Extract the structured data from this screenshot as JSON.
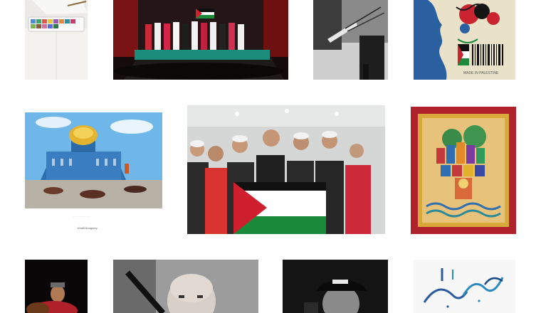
{
  "gallery": {
    "tiles": [
      {
        "id": "watercolor-palette",
        "alt": "Watercolor palette and brushes on a table",
        "caption": ""
      },
      {
        "id": "dabke-stage",
        "alt": "Dance troupe bowing on stage holding flags",
        "caption": ""
      },
      {
        "id": "artist-studio",
        "alt": "Black and white photo of an artist studio",
        "caption": ""
      },
      {
        "id": "made-in-palestine-poster",
        "alt": "Poster of a woman profile with barcode",
        "caption": "MADE IN PALESTINE"
      },
      {
        "id": "dome-of-rock-painting",
        "alt": "Surreal painting of the Dome of the Rock",
        "caption": "Khalil Anoguery"
      },
      {
        "id": "troupe-with-flag",
        "alt": "Group of performers holding a flag",
        "caption": ""
      },
      {
        "id": "jerusalem-tile-art",
        "alt": "Decorative painting of Jerusalem with ornate border",
        "caption": ""
      },
      {
        "id": "oud-player",
        "alt": "Musician playing oud on a dark stage",
        "caption": ""
      },
      {
        "id": "clarinet-player",
        "alt": "Bald musician playing a clarinet",
        "caption": ""
      },
      {
        "id": "rapper-portrait",
        "alt": "Black and white portrait of a man in a cap",
        "caption": ""
      },
      {
        "id": "arabic-calligraphy",
        "alt": "Blue Arabic calligraphy on white paper",
        "caption": ""
      }
    ]
  }
}
